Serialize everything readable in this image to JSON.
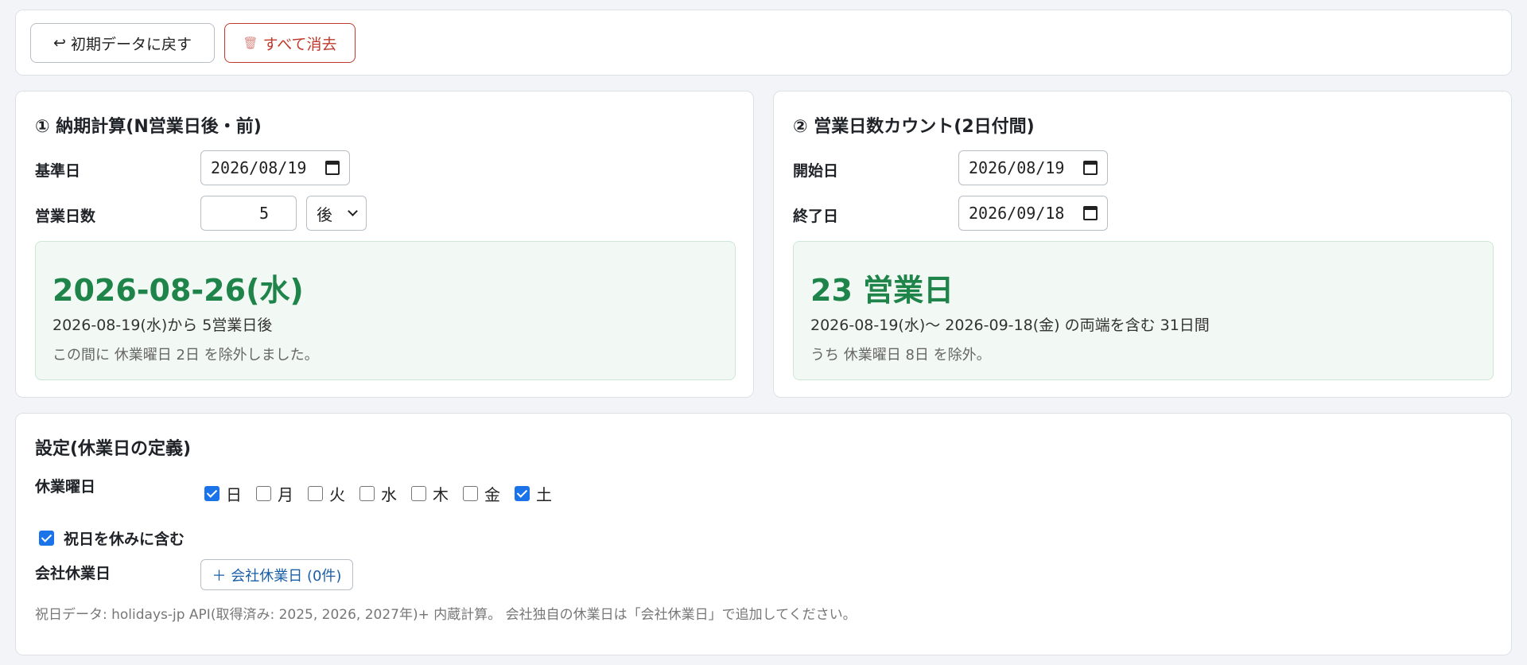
{
  "toolbar": {
    "reset_icon": "↩",
    "reset_label": "初期データに戻す",
    "clear_icon": "🗑",
    "clear_label": "すべて消去"
  },
  "calc1": {
    "title": "① 納期計算(N営業日後・前)",
    "base_date_label": "基準日",
    "base_date_value": "2026/08/19",
    "days_label": "営業日数",
    "days_value": "5",
    "direction_value": "後",
    "result_main": "2026-08-26(水)",
    "result_sub": "2026-08-19(水)から 5営業日後",
    "result_note": "この間に 休業曜日 2日 を除外しました。"
  },
  "calc2": {
    "title": "② 営業日数カウント(2日付間)",
    "start_label": "開始日",
    "start_value": "2026/08/19",
    "end_label": "終了日",
    "end_value": "2026/09/18",
    "result_main": "23 営業日",
    "result_sub": "2026-08-19(水)〜 2026-09-18(金) の両端を含む 31日間",
    "result_note": "うち 休業曜日 8日 を除外。"
  },
  "settings": {
    "title": "設定(休業日の定義)",
    "dow_label": "休業曜日",
    "dow": [
      {
        "label": "日",
        "checked": true
      },
      {
        "label": "月",
        "checked": false
      },
      {
        "label": "火",
        "checked": false
      },
      {
        "label": "水",
        "checked": false
      },
      {
        "label": "木",
        "checked": false
      },
      {
        "label": "金",
        "checked": false
      },
      {
        "label": "土",
        "checked": true
      }
    ],
    "holiday_label": "祝日を休みに含む",
    "holiday_checked": true,
    "company_label": "会社休業日",
    "company_button": "＋ 会社休業日 (0件)",
    "footnote": "祝日データ: holidays-jp API(取得済み: 2025, 2026, 2027年)+ 内蔵計算。 会社独自の休業日は「会社休業日」で追加してください。"
  },
  "colors": {
    "accent_green": "#1e8449",
    "danger_red": "#c0392b",
    "link_blue": "#1a5fa8",
    "checkbox_blue": "#1a73e8"
  }
}
